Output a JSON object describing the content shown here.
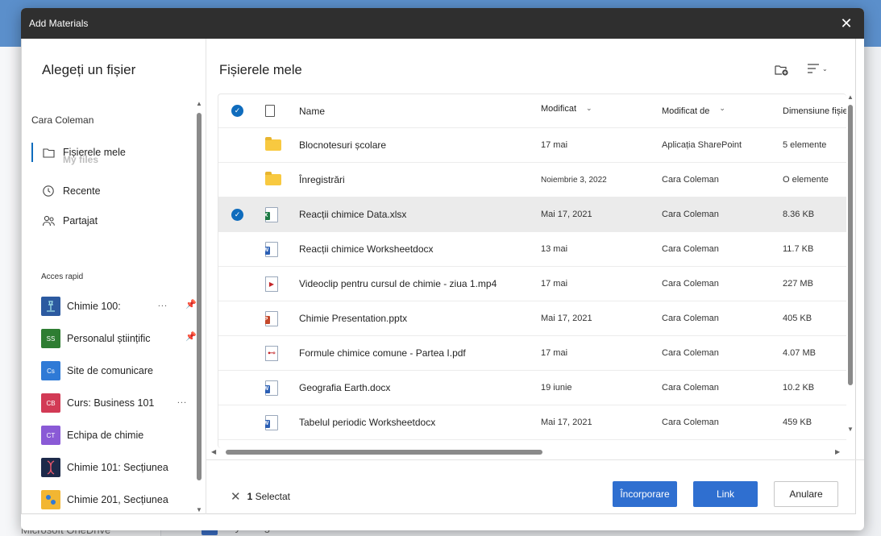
{
  "background": {
    "bottom_item": "Microsoft OneDrive",
    "assignment": "My assignment"
  },
  "dialog": {
    "title": "Add Materials",
    "close_symbol": "✕"
  },
  "left": {
    "heading": "Alegeți un fișier",
    "owner": "Cara Coleman",
    "nav": [
      {
        "label": "Fișierele mele",
        "overlay": "My files",
        "icon": "folder-icon"
      },
      {
        "label": "Recente",
        "icon": "history-icon"
      },
      {
        "label": "Partajat",
        "icon": "people-icon"
      }
    ],
    "quick_access_label": "Acces rapid",
    "quick_access": [
      {
        "label": "Chimie 100:",
        "badge": "",
        "color": "#2c5aa0",
        "more": "...",
        "pinned": true
      },
      {
        "label": "Personalul științific",
        "badge": "SS",
        "color": "#2e7d32",
        "more": "",
        "pinned": true
      },
      {
        "label": "Site de comunicare",
        "badge": "Cs",
        "color": "#2f7ad6",
        "more": "",
        "pinned": false
      },
      {
        "label": "Curs: Business 101",
        "badge": "CB",
        "color": "#d23a55",
        "more": "...",
        "pinned": false
      },
      {
        "label": "Echipa de chimie",
        "badge": "CT",
        "color": "#8a5ad6",
        "more": "",
        "pinned": false
      },
      {
        "label": "Chimie 101: Secțiunea",
        "badge": "",
        "color": "#1d2a4a",
        "more": "",
        "pinned": false
      },
      {
        "label": "Chimie 201, Secțiunea",
        "badge": "",
        "color": "#f2b632",
        "more": "",
        "pinned": false
      }
    ]
  },
  "main": {
    "heading": "Fișierele mele",
    "columns": {
      "name": "Name",
      "modified": "Modificat",
      "modified_by": "Modificat de",
      "size": "Dimensiune fișier"
    },
    "files": [
      {
        "type": "folder",
        "name": "Blocnotesuri școlare",
        "modified": "17 mai",
        "modified_by": "Aplicația SharePoint",
        "size": "5  elemente",
        "selected": false
      },
      {
        "type": "folder",
        "name": "Înregistrări",
        "modified": "Noiembrie 3, 2022",
        "modified_by": "Cara Coleman",
        "size": "O elemente",
        "selected": false
      },
      {
        "type": "xlsx",
        "name": "Reacții chimice Data.xlsx",
        "modified": "Mai 17, 2021",
        "modified_by": "Cara Coleman",
        "size": "8.36 KB",
        "selected": true
      },
      {
        "type": "docx",
        "name": "Reacții chimice Worksheetdocx",
        "modified": "13 mai",
        "modified_by": "Cara Coleman",
        "size": "11.7 KB",
        "selected": false
      },
      {
        "type": "mp4",
        "name": "Videoclip pentru cursul de chimie - ziua 1.mp4",
        "modified": "17 mai",
        "modified_by": "Cara Coleman",
        "size": "227 MB",
        "selected": false
      },
      {
        "type": "pptx",
        "name": "Chimie Presentation.pptx",
        "modified": "Mai 17, 2021",
        "modified_by": "Cara Coleman",
        "size": "405 KB",
        "selected": false
      },
      {
        "type": "pdf",
        "name": "Formule chimice comune - Partea I.pdf",
        "modified": "17 mai",
        "modified_by": "Cara Coleman",
        "size": "4.07 MB",
        "selected": false
      },
      {
        "type": "docx",
        "name": "Geografia Earth.docx",
        "modified": "19 iunie",
        "modified_by": "Cara Coleman",
        "size": "10.2 KB",
        "selected": false
      },
      {
        "type": "docx",
        "name": "Tabelul periodic Worksheetdocx",
        "modified": "Mai 17, 2021",
        "modified_by": "Cara Coleman",
        "size": "459 KB",
        "selected": false
      }
    ]
  },
  "footer": {
    "selected_count": "1",
    "selected_label": "Selectat",
    "embed_label": "Încorporare",
    "link_label": "Link",
    "cancel_label": "Anulare"
  }
}
